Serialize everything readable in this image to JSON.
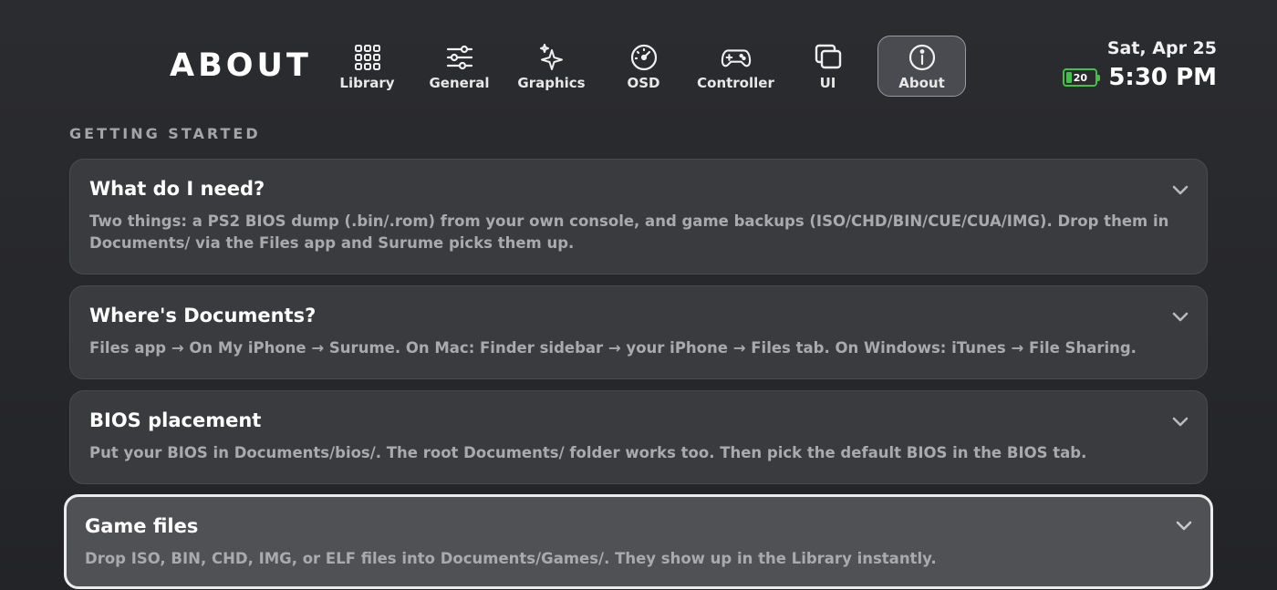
{
  "header": {
    "title": "ABOUT",
    "tabs": [
      {
        "label": "Library",
        "icon": "grid-icon"
      },
      {
        "label": "General",
        "icon": "sliders-icon"
      },
      {
        "label": "Graphics",
        "icon": "sparkles-icon"
      },
      {
        "label": "OSD",
        "icon": "gauge-icon"
      },
      {
        "label": "Controller",
        "icon": "gamepad-icon"
      },
      {
        "label": "UI",
        "icon": "windows-icon"
      },
      {
        "label": "About",
        "icon": "info-icon",
        "active": true
      }
    ]
  },
  "status": {
    "date": "Sat, Apr 25",
    "battery_level": "20",
    "battery_fraction": 0.2,
    "time": "5:30 PM",
    "battery_color": "#3ec24a"
  },
  "section": {
    "title": "GETTING STARTED"
  },
  "items": [
    {
      "title": "What do I need?",
      "body": "Two things: a PS2 BIOS dump (.bin/.rom) from your own console, and game backups (ISO/CHD/BIN/CUE/CUA/IMG). Drop them in Documents/ via the Files app and Surume picks them up."
    },
    {
      "title": "Where's Documents?",
      "body": "Files app → On My iPhone → Surume. On Mac: Finder sidebar → your iPhone → Files tab. On Windows: iTunes → File Sharing."
    },
    {
      "title": "BIOS placement",
      "body": "Put your BIOS in Documents/bios/. The root Documents/ folder works too. Then pick the default BIOS in the BIOS tab."
    },
    {
      "title": "Game files",
      "body": "Drop ISO, BIN, CHD, IMG, or ELF files into Documents/Games/. They show up in the Library instantly.",
      "focused": true
    }
  ]
}
